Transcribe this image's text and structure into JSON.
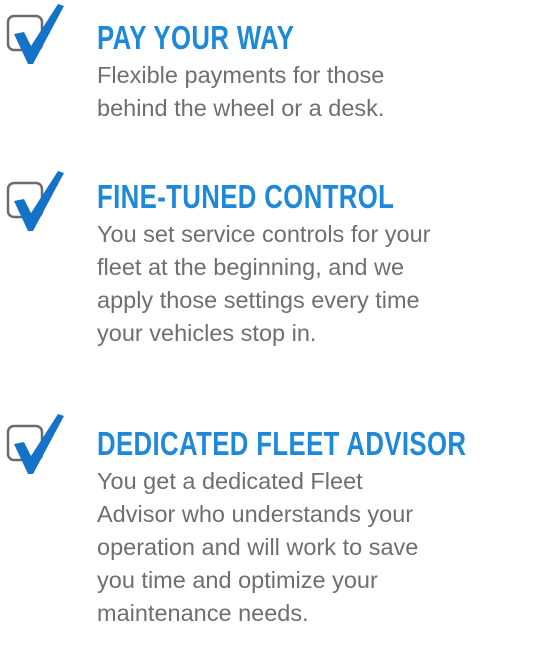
{
  "features": [
    {
      "icon": "checkbox-checked-icon",
      "title": "PAY YOUR WAY",
      "lines": [
        "Flexible payments for those",
        "behind the wheel or a desk."
      ]
    },
    {
      "icon": "checkbox-checked-icon",
      "title": "FINE-TUNED CONTROL",
      "lines": [
        "You set service controls for your",
        "fleet at the beginning, and we",
        "apply those settings every time",
        "your vehicles stop in."
      ]
    },
    {
      "icon": "checkbox-checked-icon",
      "title": "DEDICATED FLEET ADVISOR",
      "lines": [
        "You get a dedicated Fleet",
        "Advisor who understands your",
        "operation and will work to save",
        "you time and optimize your",
        "maintenance needs."
      ]
    }
  ],
  "colors": {
    "heading": "#1e88d9",
    "check": "#1473c9",
    "body_text": "#6f6f6f",
    "box_border": "#6b6b6b"
  }
}
